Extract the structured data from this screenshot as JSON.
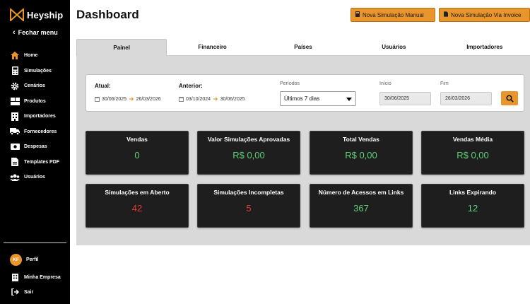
{
  "app": {
    "name": "Heyship",
    "brand_color": "#e8962c"
  },
  "sidebar": {
    "collapse_label": "Fechar menu",
    "items": [
      {
        "label": "Home",
        "icon": "home-icon"
      },
      {
        "label": "Simulações",
        "icon": "calculator-icon"
      },
      {
        "label": "Cenários",
        "icon": "gear-icon"
      },
      {
        "label": "Produtos",
        "icon": "boxes-icon"
      },
      {
        "label": "Importadores",
        "icon": "building-icon"
      },
      {
        "label": "Fornecedores",
        "icon": "truck-icon"
      },
      {
        "label": "Despesas",
        "icon": "money-icon"
      },
      {
        "label": "Templates PDF",
        "icon": "pdf-icon"
      },
      {
        "label": "Usuários",
        "icon": "users-icon"
      }
    ],
    "bottom": {
      "profile": {
        "initials": "KF",
        "label": "Perfil"
      },
      "company": {
        "label": "Minha Empresa",
        "icon": "building-icon"
      },
      "logout": {
        "label": "Sair",
        "icon": "logout-icon"
      }
    }
  },
  "header": {
    "title": "Dashboard",
    "btn_manual": "Nova Simulação Manual",
    "btn_invoice": "Nova Simulação Via Invoice"
  },
  "tabs": [
    "Painel",
    "Financeiro",
    "Países",
    "Usuários",
    "Importadores"
  ],
  "active_tab": "Painel",
  "filters": {
    "atual_label": "Atual:",
    "atual_from": "30/06/2025",
    "atual_to": "26/03/2026",
    "anterior_label": "Anterior:",
    "anterior_from": "03/10/2024",
    "anterior_to": "30/06/2025",
    "periodos_label": "Períodos",
    "periodos_value": "Últimos 7 dias",
    "inicio_label": "Início",
    "inicio_value": "30/06/2025",
    "fim_label": "Fim",
    "fim_value": "26/03/2026"
  },
  "cards": [
    {
      "title": "Vendas",
      "value": "0",
      "color": "#5fd07a"
    },
    {
      "title": "Valor Simulações Aprovadas",
      "value": "R$ 0,00",
      "color": "#5fd07a"
    },
    {
      "title": "Total Vendas",
      "value": "R$ 0,00",
      "color": "#5fd07a"
    },
    {
      "title": "Vendas Média",
      "value": "R$ 0,00",
      "color": "#5fd07a"
    },
    {
      "title": "Simulações em Aberto",
      "value": "42",
      "color": "#e23b2c"
    },
    {
      "title": "Simulações Incompletas",
      "value": "5",
      "color": "#e23b2c"
    },
    {
      "title": "Número de Acessos em Links",
      "value": "367",
      "color": "#5fd07a"
    },
    {
      "title": "Links Expirando",
      "value": "12",
      "color": "#5fd07a"
    }
  ]
}
